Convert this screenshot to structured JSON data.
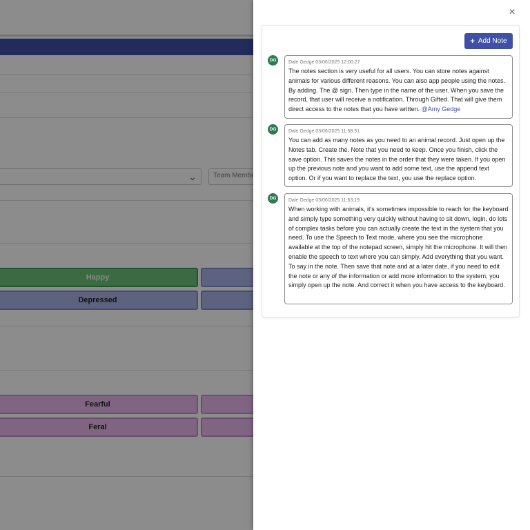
{
  "background": {
    "team_member_placeholder": "Team Member",
    "moods": {
      "happy": "Happy",
      "depressed": "Depressed",
      "fearful": "Fearful",
      "feral": "Feral"
    }
  },
  "panel": {
    "add_note_label": "Add Note",
    "close_icon": "×",
    "notes": [
      {
        "initials": "DG",
        "meta": "Dale Gedge 03/06/2025 12:00:27",
        "text": "The notes section is very useful for all users. You can store notes against animals for various different reasons. You can also app people using the notes. By adding. The @ sign. Then type in the name of the user. When you save the record, that user will receive a notification. Through Gifted. That will give them direct access to the notes that you have written.",
        "mention": "@Amy  Gedge"
      },
      {
        "initials": "DG",
        "meta": "Dale Gedge 03/06/2025 11:58:51",
        "text": "You can add as many notes as you need to an animal record. Just open up the Notes tab. Create the. Note that you need to keep. Once you finish, click the save option. This saves the notes in the order that they were taken. If you open up the previous note and you want to add some text, use the append text option. Or if you want to replace the text, you use the replace option."
      },
      {
        "initials": "DG",
        "meta": "Dale Gedge 03/06/2025 11:53:19",
        "text": "When working with animals, it's sometimes impossible to reach for the keyboard and simply type something very quickly without having to sit down, login, do lots of complex tasks before you can actually create the text in the system that you need. To use the Speech to Text mode, where you see the microphone available at the top of the notepad screen, simply hit the microphone. It will then enable the speech to text where you can simply. Add everything that you want. To say in the note. Then save that note and at a later date, if you need to edit the note or any of the information or add more information to the system, you simply open up the note. And correct it when you have access to the keyboard."
      }
    ]
  }
}
